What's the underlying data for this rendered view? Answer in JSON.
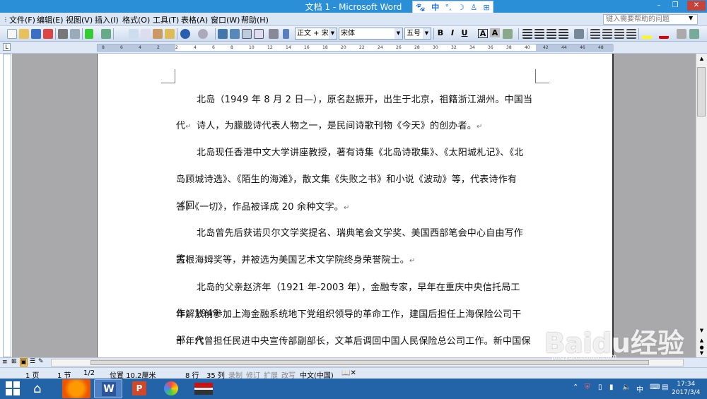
{
  "window": {
    "title": "文档 1 - Microsoft Word",
    "minimize": "–",
    "restore": "❐",
    "close": "✕"
  },
  "ime": {
    "paw": "🐾",
    "lang": "中",
    "dot": "°,",
    "moon": "☽",
    "person": "♙",
    "grid": "⊞"
  },
  "menu": {
    "items": [
      "文件(F)",
      "编辑(E)",
      "视图(V)",
      "插入(I)",
      "格式(O)",
      "工具(T)",
      "表格(A)",
      "窗口(W)",
      "帮助(H)"
    ]
  },
  "help_search": {
    "placeholder": "键入需要帮助的问题"
  },
  "toolbar": {
    "style": "正文 + 宋体",
    "font": "宋体",
    "size": "五号",
    "bold": "B",
    "italic": "I",
    "underline": "U",
    "char_border": "A",
    "char_scale": "A"
  },
  "document": {
    "paragraphs": [
      "北岛（1949 年 8 月 2 日—），原名赵振开，出生于北京，祖籍浙江湖州。中国当代",
      "诗人，为朦胧诗代表人物之一，是民间诗歌刊物《今天》的创办者。",
      "北岛现任香港中文大学讲座教授，著有诗集《北岛诗歌集》、《太阳城札记》、《北",
      "岛顾城诗选》、《陌生的海滩》，散文集《失败之书》和小说《波动》等，代表诗作有《回",
      "答》《一切》，作品被译成 20 余种文字。",
      "北岛曾先后获诺贝尔文学奖提名、瑞典笔会文学奖、美国西部笔会中心自由写作奖、",
      "古根海姆奖等，并被选为美国艺术文学院终身荣誉院士。",
      "北岛的父亲赵济年（1921 年-2003 年），金融专家，早年在重庆中央信托局工作，1949",
      "年解放前参加上海金融系统地下党组织领导的革命工作，建国后担任上海保险公司干部，六",
      "十年代曾担任民进中央宣传部副部长，文革后调回中国人民保险总公司工作。新中国保险业"
    ],
    "para_mark": "↵"
  },
  "status": {
    "page": "1 页",
    "section": "1 节",
    "pages": "1/2",
    "position": "位置 10.2厘米",
    "line": "8 行",
    "column": "35 列",
    "rec": "录制",
    "trk": "修订",
    "ext": "扩展",
    "ovr": "改写",
    "lang": "中文(中国)"
  },
  "taskbar": {
    "clock_time": "17:34",
    "clock_date": "2017/3/4",
    "ime": "中"
  },
  "watermark": {
    "brand": "Baidu经验",
    "url": "jingyan.baidu.com"
  },
  "ruler_ticks": [
    "8",
    "6",
    "4",
    "2",
    "2",
    "4",
    "6",
    "8",
    "10",
    "12",
    "14",
    "16",
    "18",
    "20",
    "22",
    "24",
    "26",
    "28",
    "30",
    "32",
    "34",
    "36",
    "38",
    "40",
    "42",
    "44",
    "46",
    "48"
  ]
}
